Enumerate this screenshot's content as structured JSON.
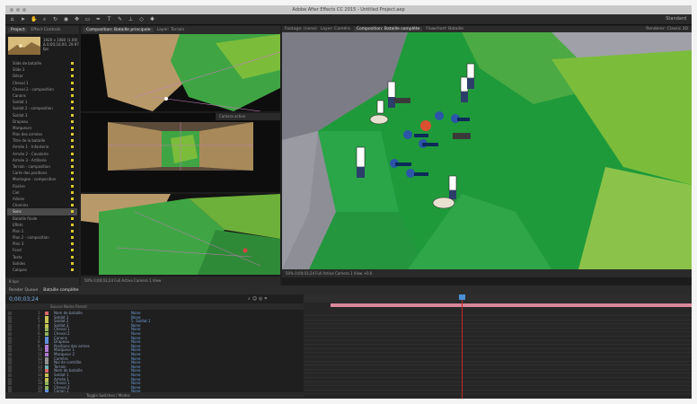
{
  "window": {
    "title": "Adobe After Effects CC 2015 - Untitled Project.aep"
  },
  "toolbar": {
    "tools": [
      "home-icon",
      "arrow-icon",
      "hand-icon",
      "zoom-icon",
      "rotate-icon",
      "camera-icon",
      "pan-icon",
      "rect-icon",
      "pen-icon",
      "text-icon",
      "brush-icon",
      "stamp-icon",
      "eraser-icon",
      "puppet-icon"
    ],
    "workspace": "Standard"
  },
  "project_panel": {
    "tabs": [
      "Project",
      "Effect Controls"
    ],
    "info_lines": [
      "1920 x 1080 (1.00)",
      "Δ 0;00;10;00, 29.97 fps"
    ],
    "items": [
      "Slide de bataille",
      "Slide 2",
      "Décor",
      "Cheval 1",
      "Cheval 2 - composition",
      "Canons",
      "Soldat 1",
      "Soldat 2 - composition",
      "Soldat 3",
      "Drapeau",
      "Marqueurs",
      "Plan des armées",
      "Titre de la bataille",
      "Armée 1 - Infanterie",
      "Armée 2 - Cavalerie",
      "Armée 3 - Artillerie",
      "Terrain - composition",
      "Carte des positions",
      "Montagne - composition",
      "Rivière",
      "Ciel",
      "Arbres",
      "Chemins",
      "Sons",
      "Bataille finale",
      "Effets",
      "Plan 1",
      "Plan 2 - composition",
      "Plan 3",
      "Fond",
      "Texte",
      "Solides",
      "Calques"
    ],
    "selected_index": 23,
    "footer": "8 bpc"
  },
  "viewer_left": {
    "tabs": [
      "Composition: Bataille principale",
      "Layer: Terrain"
    ],
    "active_camera": "Camera active",
    "bottom_bar": "50%  0;00;03;24  Full  Active Camera  1 View"
  },
  "comp_viewer": {
    "tabs": [
      "Footage: (none)",
      "Layer: Caméra",
      "Composition: Bataille complète",
      "Flowchart: Bataille"
    ],
    "renderer": "Renderer: Classic 3D",
    "bottom_bar": "50%  0;00;03;24  Full  Active Camera  1 View  +0.0"
  },
  "timeline": {
    "tabs": [
      "Render Queue",
      "Bataille complète"
    ],
    "current_time": "0;00;03;24",
    "columns": "Source Name     Parent",
    "layers": [
      {
        "idx": "1",
        "name": "Nom de bataille",
        "parent": "None",
        "color": "#d86a6a"
      },
      {
        "idx": "2",
        "name": "Soldat 1",
        "parent": "None",
        "color": "#c6c254"
      },
      {
        "idx": "3",
        "name": "Soldat 2",
        "parent": "5. Soldat 1",
        "color": "#c6c254"
      },
      {
        "idx": "4",
        "name": "Soldat 3",
        "parent": "None",
        "color": "#c6c254"
      },
      {
        "idx": "5",
        "name": "Cheval 1",
        "parent": "None",
        "color": "#8fb35c"
      },
      {
        "idx": "6",
        "name": "Cheval 2",
        "parent": "None",
        "color": "#8fb35c"
      },
      {
        "idx": "7",
        "name": "Canons",
        "parent": "None",
        "color": "#5f8fd6"
      },
      {
        "idx": "8",
        "name": "Drapeau",
        "parent": "None",
        "color": "#5f8fd6"
      },
      {
        "idx": "9",
        "name": "Positions des armes",
        "parent": "None",
        "color": "#b07ad0"
      },
      {
        "idx": "10",
        "name": "Marqueur 1",
        "parent": "None",
        "color": "#b07ad0"
      },
      {
        "idx": "11",
        "name": "Marqueur 2",
        "parent": "None",
        "color": "#b07ad0"
      },
      {
        "idx": "12",
        "name": "Caméra",
        "parent": "None",
        "color": "#909090"
      },
      {
        "idx": "13",
        "name": "Nul de contrôle",
        "parent": "None",
        "color": "#909090"
      },
      {
        "idx": "14",
        "name": "Terrain",
        "parent": "None",
        "color": "#6cb0b0"
      },
      {
        "idx": "15",
        "name": "Nom de bataille",
        "parent": "None",
        "color": "#d86a6a"
      },
      {
        "idx": "16",
        "name": "Soldat 1",
        "parent": "None",
        "color": "#c6c254"
      },
      {
        "idx": "17",
        "name": "Armée 1",
        "parent": "None",
        "color": "#c6c254"
      },
      {
        "idx": "18",
        "name": "Cheval 1",
        "parent": "None",
        "color": "#8fb35c"
      },
      {
        "idx": "19",
        "name": "Cheval 2",
        "parent": "None",
        "color": "#8fb35c"
      },
      {
        "idx": "20",
        "name": "Canon 1",
        "parent": "None",
        "color": "#5f8fd6"
      }
    ],
    "footer": "Toggle Switches / Modes"
  },
  "colors": {
    "accent": "#4a90d8",
    "work_area": "#d9889b",
    "playhead": "#c02828",
    "terrain_dark": "#1f9a3a",
    "terrain_light": "#7bbd3b",
    "rock": "#8a8a92"
  }
}
